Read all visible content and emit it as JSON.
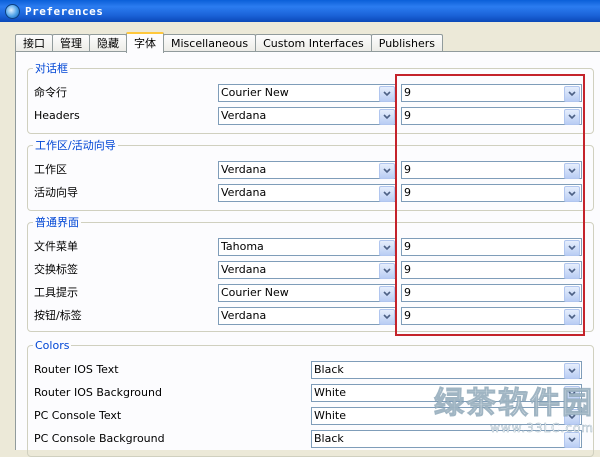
{
  "window": {
    "title": "Preferences"
  },
  "tabs": [
    "接口",
    "管理",
    "隐藏",
    "字体",
    "Miscellaneous",
    "Custom Interfaces",
    "Publishers"
  ],
  "active_tab": "字体",
  "groups": {
    "dialog": {
      "legend": "对话框",
      "rows": [
        {
          "label": "命令行",
          "font": "Courier New",
          "size": "9"
        },
        {
          "label": "Headers",
          "font": "Verdana",
          "size": "9"
        }
      ]
    },
    "workspace": {
      "legend": "工作区/活动向导",
      "rows": [
        {
          "label": "工作区",
          "font": "Verdana",
          "size": "9"
        },
        {
          "label": "活动向导",
          "font": "Verdana",
          "size": "9"
        }
      ]
    },
    "general": {
      "legend": "普通界面",
      "rows": [
        {
          "label": "文件菜单",
          "font": "Tahoma",
          "size": "9"
        },
        {
          "label": "交换标签",
          "font": "Verdana",
          "size": "9"
        },
        {
          "label": "工具提示",
          "font": "Courier New",
          "size": "9"
        },
        {
          "label": "按钮/标签",
          "font": "Verdana",
          "size": "9"
        }
      ]
    },
    "colors": {
      "legend": "Colors",
      "rows": [
        {
          "label": "Router IOS Text",
          "color": "Black"
        },
        {
          "label": "Router IOS Background",
          "color": "White"
        },
        {
          "label": "PC Console Text",
          "color": "White"
        },
        {
          "label": "PC Console Background",
          "color": "Black"
        }
      ]
    }
  },
  "watermark": {
    "main": "绿茶软件园",
    "sub": "www.33LC.com"
  },
  "theme": {
    "legend_color": "#0046d5",
    "highlight_color": "#c4232b",
    "tab_accent": "#ffc83c"
  }
}
